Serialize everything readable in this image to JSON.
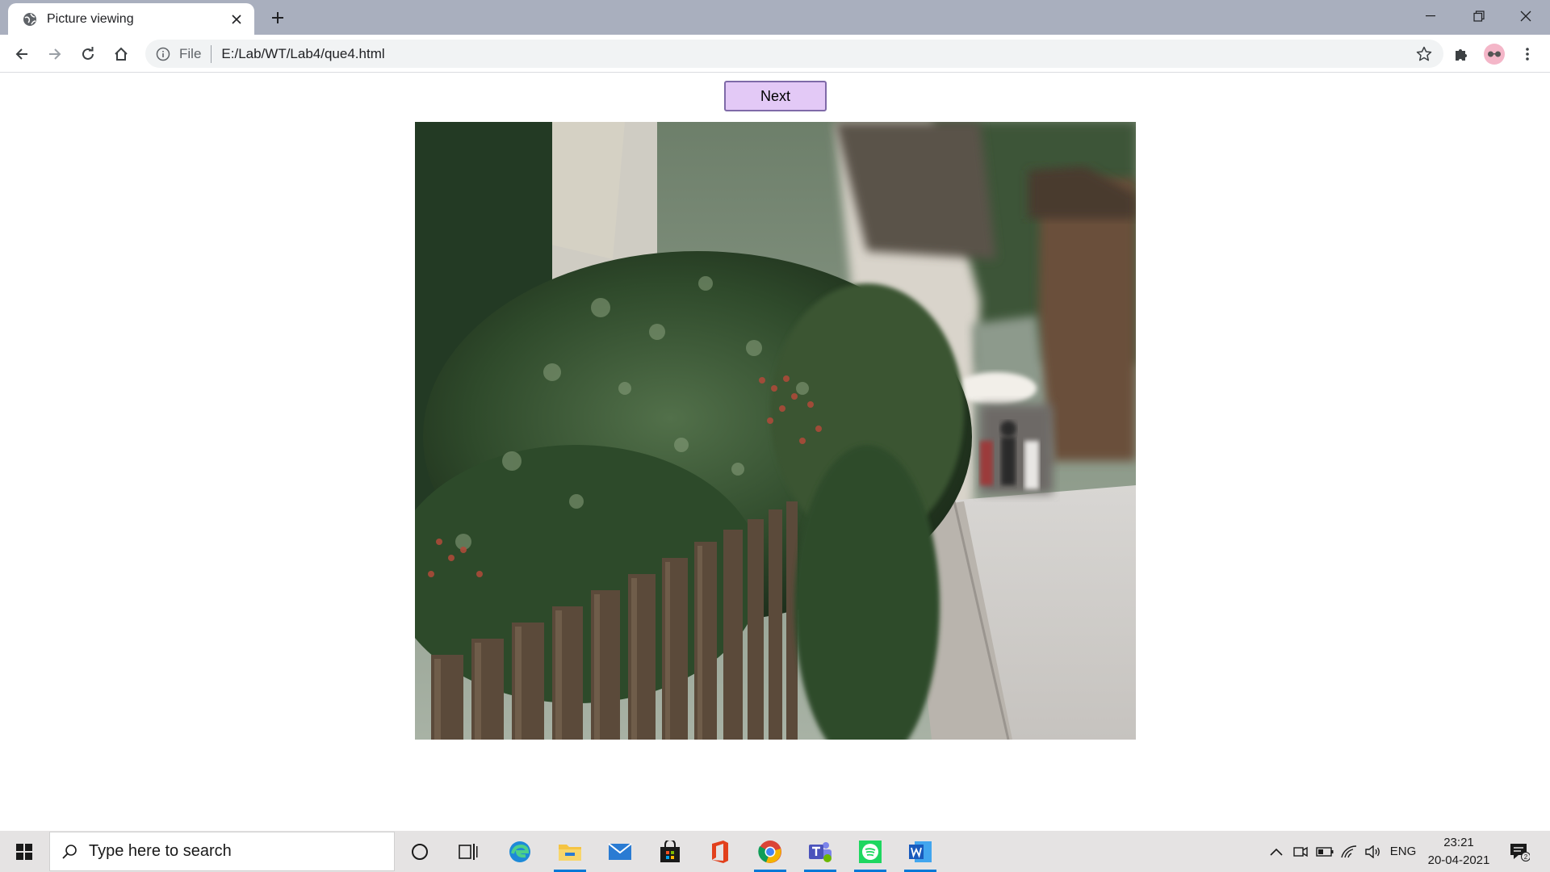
{
  "browser": {
    "tab": {
      "title": "Picture viewing",
      "favicon": "globe-icon"
    },
    "address": {
      "scheme_label": "File",
      "url": "E:/Lab/WT/Lab4/que4.html"
    }
  },
  "page": {
    "next_button_label": "Next",
    "image": {
      "description_icon": "photo-street-hedge-fence"
    }
  },
  "taskbar": {
    "search_placeholder": "Type here to search",
    "language": "ENG",
    "time": "23:21",
    "date": "20-04-2021",
    "notification_count": "2",
    "pinned_apps": [
      "cortana",
      "task-view",
      "edge",
      "file-explorer",
      "mail",
      "store",
      "office",
      "chrome",
      "teams",
      "spotify",
      "word"
    ]
  },
  "colors": {
    "tabstrip": "#a9afbe",
    "next_button_bg": "#e3c9f6",
    "next_button_border": "#7f6aa8",
    "taskbar_bg": "#e5e3e3",
    "active_indicator": "#0078d7"
  }
}
